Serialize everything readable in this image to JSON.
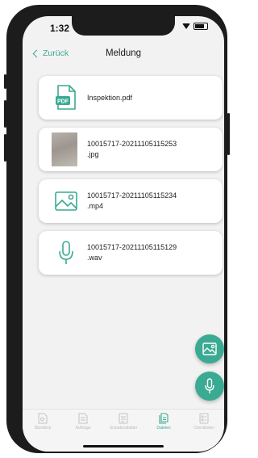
{
  "status_bar": {
    "time": "1:32"
  },
  "nav": {
    "back_label": "Zurück",
    "title": "Meldung"
  },
  "files": [
    {
      "type": "pdf",
      "icon": "pdf-file-icon",
      "name": "Inspektion.pdf"
    },
    {
      "type": "jpg",
      "icon": "image-thumbnail",
      "name": "10015717-20211105115253\n.jpg"
    },
    {
      "type": "mp4",
      "icon": "image-file-icon",
      "name": "10015717-20211105115234\n.mp4"
    },
    {
      "type": "wav",
      "icon": "microphone-icon",
      "name": "10015717-20211105115129\n.wav"
    }
  ],
  "fabs": [
    {
      "icon": "add-image-icon"
    },
    {
      "icon": "microphone-icon"
    }
  ],
  "tabs": [
    {
      "label": "Überblick",
      "icon": "overview-icon",
      "active": false
    },
    {
      "label": "Aufträge",
      "icon": "orders-icon",
      "active": false
    },
    {
      "label": "Schadensbilder",
      "icon": "damage-images-icon",
      "active": false
    },
    {
      "label": "Dateien",
      "icon": "files-icon",
      "active": true
    },
    {
      "label": "Checklisten",
      "icon": "checklist-icon",
      "active": false
    }
  ],
  "colors": {
    "accent": "#3aaa92",
    "background": "#f2f2f2",
    "card": "#ffffff",
    "inactive_tab": "#b8b8b8"
  }
}
